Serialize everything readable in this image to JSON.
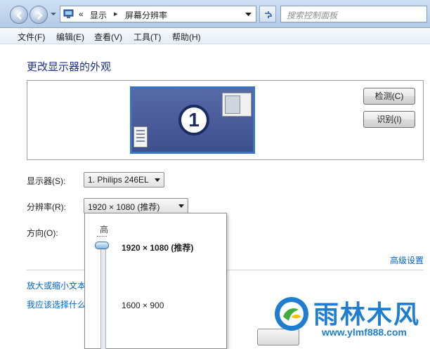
{
  "address_bar": {
    "breadcrumb_prefix": "«",
    "crumbs": [
      "显示",
      "屏幕分辨率"
    ],
    "crumb_separator": "▸",
    "search_placeholder": "搜索控制面板"
  },
  "menu": {
    "items": [
      "文件(F)",
      "编辑(E)",
      "查看(V)",
      "工具(T)",
      "帮助(H)"
    ]
  },
  "main": {
    "title": "更改显示器的外观",
    "monitor_number": "1",
    "detect_button": "检测(C)",
    "identify_button": "识别(I)",
    "display_label": "显示器(S):",
    "display_value": "1. Philips 246EL",
    "resolution_label": "分辨率(R):",
    "resolution_value": "1920 × 1080 (推荐)",
    "orientation_label": "方向(O):",
    "advanced_link": "高级设置",
    "link_text_size": "放大或缩小文本",
    "link_which_setting": "我应该选择什么"
  },
  "resolution_dropdown": {
    "high_label": "高",
    "options": [
      "1920 × 1080 (推荐)",
      "1600 × 900"
    ],
    "selected_index": 0
  },
  "watermark": {
    "title": "雨林木风",
    "url": "www.ylmf888.com"
  },
  "colors": {
    "title_blue": "#1e3287",
    "link_blue": "#0066cc",
    "watermark_blue": "#1f7ed0",
    "watermark_green": "#3fae3a"
  }
}
